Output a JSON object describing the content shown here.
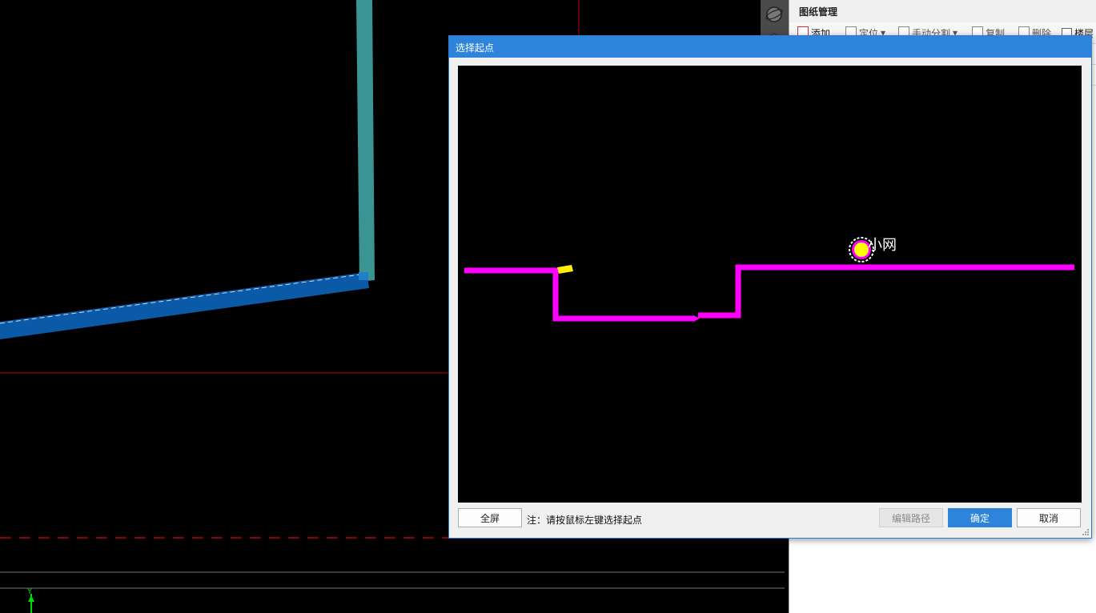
{
  "dialog": {
    "title": "选择起点",
    "hint": "注：请按鼠标左键选择起点",
    "buttons": {
      "fullscreen": "全屏",
      "edit_path": "编辑路径",
      "confirm": "确定",
      "cancel": "取消"
    },
    "preview_label": "小网"
  },
  "right_panel": {
    "title": "图纸管理",
    "toolbar": {
      "add": "添加",
      "locate": "定位",
      "manual_split": "手动分割",
      "copy": "复制",
      "delete": "删除",
      "floor": "楼层"
    }
  },
  "cad": {
    "axis_label": "Y"
  },
  "colors": {
    "accent": "#2e84db",
    "pipe": "#ff00ff",
    "start_point": "#ffff00",
    "wall_vertical": "#3a9494",
    "wall_horizontal": "#0a5aa8",
    "grid_red": "#c00000"
  }
}
